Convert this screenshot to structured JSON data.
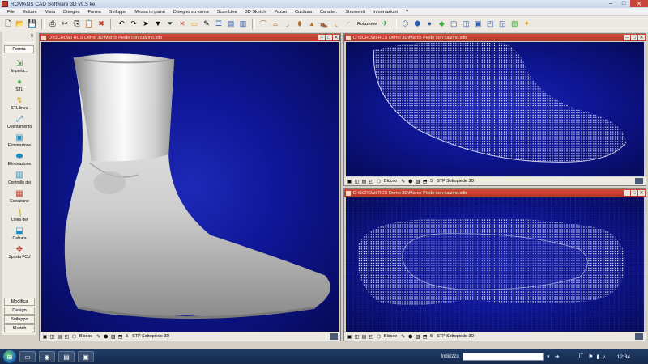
{
  "window": {
    "title": "ROMANS CAD Software 3D v9.5 ke",
    "controls": {
      "minimize": "–",
      "maximize": "□",
      "close": "✕"
    }
  },
  "menu": [
    "File",
    "Editare",
    "Vista",
    "Disegno",
    "Forma",
    "Sviluppo",
    "Messa in piano",
    "Disegno su forma",
    "Scan Line",
    "3D Sketch",
    "Pezzo",
    "Cucitura",
    "Caratter.",
    "Strumenti",
    "Informazioni",
    "?"
  ],
  "toolbar": {
    "rotation_label": "Rotazione"
  },
  "left_panel": {
    "close_icon": "✕",
    "active_tab": "Forma",
    "tools": [
      {
        "label": "Importa...",
        "icon": "import-icon",
        "glyph": "⇲"
      },
      {
        "label": "STL",
        "icon": "stl-sphere-icon",
        "glyph": "●"
      },
      {
        "label": "STL linea",
        "icon": "stl-line-icon",
        "glyph": "↯"
      },
      {
        "label": "Orientamento",
        "icon": "orientation-icon",
        "glyph": "⤢"
      },
      {
        "label": "Eliminazione",
        "icon": "delete-icon",
        "glyph": "▣"
      },
      {
        "label": "Eliminazione",
        "icon": "delete-sole-icon",
        "glyph": "⬬"
      },
      {
        "label": "Controllo dei",
        "icon": "check-icon",
        "glyph": "▥"
      },
      {
        "label": "Estrazione",
        "icon": "extraction-icon",
        "glyph": "▦"
      },
      {
        "label": "Linea del",
        "icon": "line-icon",
        "glyph": "⎞"
      },
      {
        "label": "Calzata",
        "icon": "fit-icon",
        "glyph": "⬓"
      },
      {
        "label": "Sposta FCU",
        "icon": "move-icon",
        "glyph": "✥"
      }
    ],
    "bottom_tabs": [
      "Modifica",
      "Design",
      "Sviluppo",
      "Sketch"
    ]
  },
  "views": {
    "main": {
      "title": "D:\\SCRDati RCS Demo 3D\\Marco Piede con calzino.stlb",
      "status": {
        "blocco": "Blocco",
        "num": "5",
        "stp": "STP Sottopiede 3D"
      }
    },
    "top_right": {
      "title": "D:\\SCRDati RCS Demo 3D\\Marco Piede con calzino.stlb",
      "status": {
        "blocco": "Blocco",
        "num": "5",
        "stp": "STP Sottopiede 3D"
      }
    },
    "bottom_right": {
      "title": "D:\\SCRDati RCS Demo 3D\\Marco Piede con calzino.stlb",
      "status": {
        "blocco": "Blocco",
        "num": "5",
        "stp": "STP Sottopiede 3D"
      }
    }
  },
  "taskbar": {
    "address_label": "Indirizzo",
    "address_value": "",
    "language": "IT",
    "time": "12:34"
  },
  "colors": {
    "viewport_bg": "#0e1696",
    "view_title_bg": "#c0392b",
    "accent": "#2e5fb6"
  }
}
